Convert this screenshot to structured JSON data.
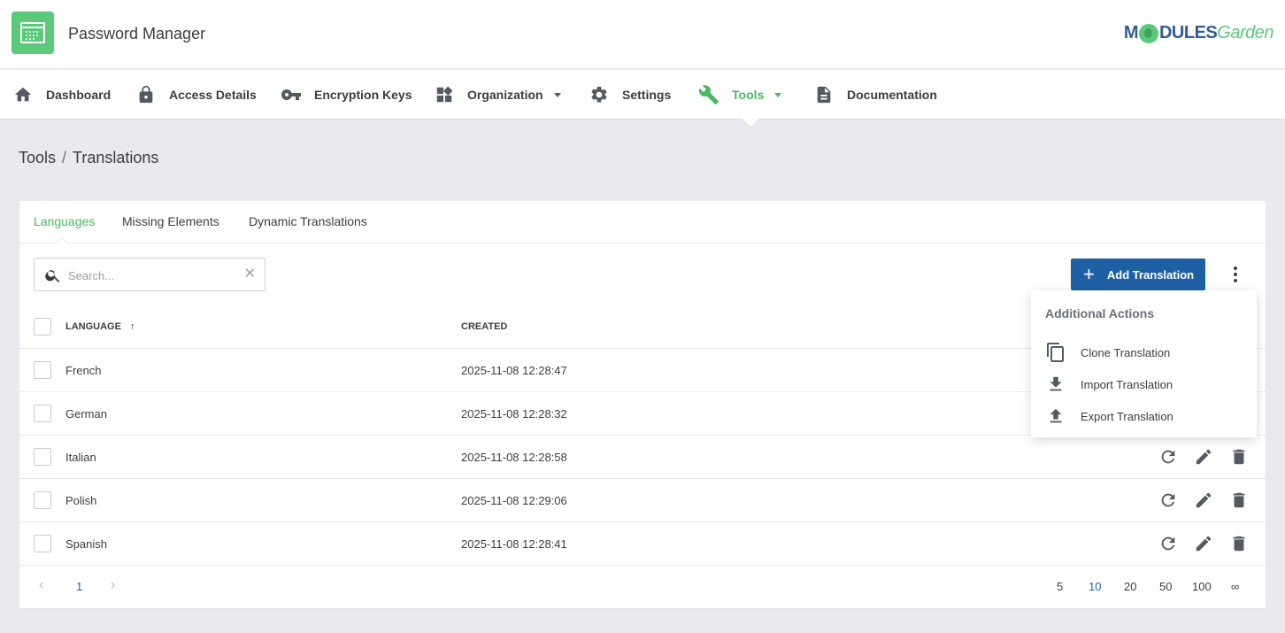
{
  "header": {
    "app_title": "Password Manager",
    "brand_left": "M",
    "brand_mid": "DULES",
    "brand_garden": "Garden"
  },
  "nav": {
    "items": [
      {
        "label": "Dashboard",
        "icon": "home-icon"
      },
      {
        "label": "Access Details",
        "icon": "lock-icon"
      },
      {
        "label": "Encryption Keys",
        "icon": "key-icon"
      },
      {
        "label": "Organization",
        "icon": "widgets-icon",
        "dropdown": true
      },
      {
        "label": "Settings",
        "icon": "gear-icon"
      },
      {
        "label": "Tools",
        "icon": "wrench-icon",
        "dropdown": true,
        "active": true
      },
      {
        "label": "Documentation",
        "icon": "document-icon"
      }
    ]
  },
  "breadcrumb": {
    "parent": "Tools",
    "separator": "/",
    "current": "Translations"
  },
  "tabs": [
    {
      "label": "Languages",
      "active": true
    },
    {
      "label": "Missing Elements"
    },
    {
      "label": "Dynamic Translations"
    }
  ],
  "search": {
    "placeholder": "Search...",
    "value": ""
  },
  "toolbar": {
    "add_label": "Add Translation"
  },
  "table": {
    "columns": {
      "language": "LANGUAGE",
      "language_sort": "↑",
      "created": "CREATED"
    },
    "rows": [
      {
        "language": "French",
        "created": "2025-11-08 12:28:47"
      },
      {
        "language": "German",
        "created": "2025-11-08 12:28:32"
      },
      {
        "language": "Italian",
        "created": "2025-11-08 12:28:58"
      },
      {
        "language": "Polish",
        "created": "2025-11-08 12:29:06"
      },
      {
        "language": "Spanish",
        "created": "2025-11-08 12:28:41"
      }
    ]
  },
  "pagination": {
    "prev": "‹",
    "current_page": "1",
    "next": "›",
    "page_sizes": [
      "5",
      "10",
      "20",
      "50",
      "100",
      "∞"
    ],
    "selected_size": "10"
  },
  "dropdown": {
    "title": "Additional Actions",
    "items": [
      {
        "label": "Clone Translation",
        "icon": "copy-icon"
      },
      {
        "label": "Import Translation",
        "icon": "download-icon"
      },
      {
        "label": "Export Translation",
        "icon": "upload-icon"
      }
    ]
  },
  "colors": {
    "accent": "#4cb85f",
    "primary": "#1f5fa3",
    "background": "#e9eaef"
  }
}
